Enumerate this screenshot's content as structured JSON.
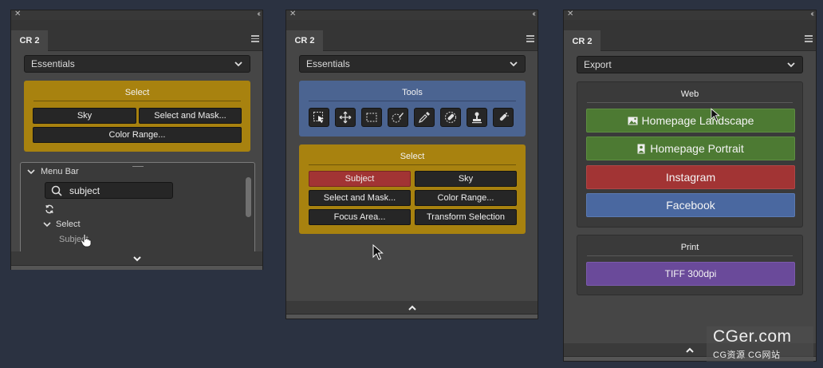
{
  "panels": [
    {
      "tab": "CR 2",
      "dropdown": "Essentials",
      "select_box": {
        "title": "Select",
        "buttons": [
          "Sky",
          "Select and Mask...",
          "Color Range..."
        ]
      },
      "tree": {
        "root": "Menu Bar",
        "search_value": "subject",
        "node": "Select",
        "child": "Subject"
      }
    },
    {
      "tab": "CR 2",
      "dropdown": "Essentials",
      "tools_box": {
        "title": "Tools",
        "tools": [
          "select-subject-icon",
          "move-icon",
          "marquee-icon",
          "quick-selection-icon",
          "eyedropper-icon",
          "healing-brush-icon",
          "stamp-icon",
          "spot-healing-icon"
        ]
      },
      "select_box": {
        "title": "Select",
        "buttons": [
          "Subject",
          "Sky",
          "Select and Mask...",
          "Color Range...",
          "Focus Area...",
          "Transform Selection"
        ]
      }
    },
    {
      "tab": "CR 2",
      "dropdown": "Export",
      "web_box": {
        "title": "Web",
        "buttons": [
          "Homepage Landscape",
          "Homepage Portrait",
          "Instagram",
          "Facebook"
        ]
      },
      "print_box": {
        "title": "Print",
        "buttons": [
          "TIFF 300dpi"
        ]
      }
    }
  ],
  "colors": {
    "gold": "#a8820f",
    "blue": "#4b6491",
    "red": "#a23434",
    "green": "#4d7a33",
    "fb_blue": "#4a68a0",
    "purple": "#6a4a9a"
  },
  "watermark": {
    "main": "CGer.com",
    "sub": "CG资源 CG网站"
  }
}
